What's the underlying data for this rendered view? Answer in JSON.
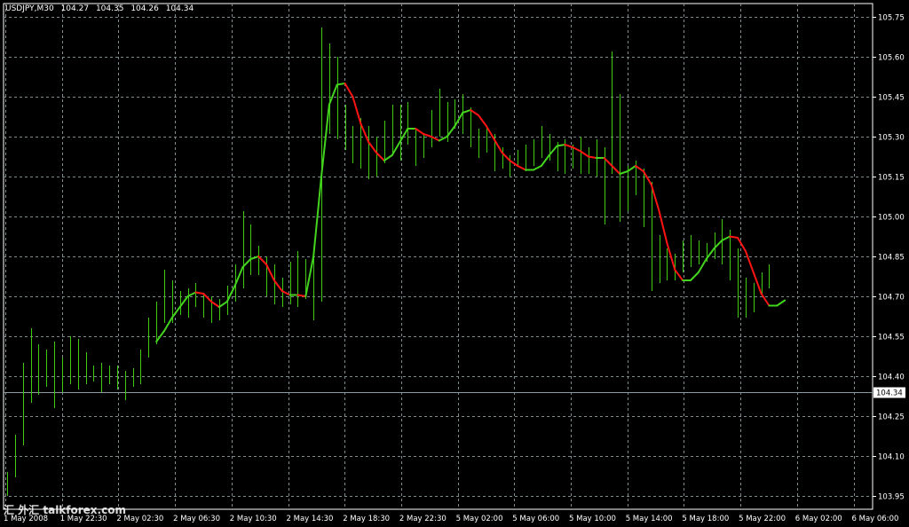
{
  "header": {
    "symbol": "USDJPY,M30",
    "open": "104.27",
    "high": "104.35",
    "low": "104.26",
    "close": "104.34"
  },
  "watermark": "汇 外汇 talkforex.com",
  "colors": {
    "background": "#000000",
    "grid": "#7f8c8d",
    "bars": "#3ecb12",
    "ma_up": "#43d41e",
    "ma_down": "#ff1414",
    "axis": "#ffffff",
    "bid_line": "#8c9aa3",
    "text": "#ffffff"
  },
  "chart_data": {
    "type": "line",
    "title": "USDJPY,M30",
    "price_axis_ticks": [
      "105.75",
      "105.60",
      "105.45",
      "105.30",
      "105.15",
      "105.00",
      "104.85",
      "104.70",
      "104.55",
      "104.40",
      "104.25",
      "104.10",
      "103.95"
    ],
    "time_axis_ticks": [
      "1 May 2008",
      "1 May 22:30",
      "2 May 02:30",
      "2 May 06:30",
      "2 May 10:30",
      "2 May 14:30",
      "2 May 18:30",
      "2 May 22:30",
      "5 May 02:00",
      "5 May 06:00",
      "5 May 10:00",
      "5 May 14:00",
      "5 May 18:00",
      "5 May 22:00",
      "6 May 02:00",
      "6 May 06:00"
    ],
    "ylim": [
      103.9,
      105.8
    ],
    "current_price": "104.34",
    "grid": true,
    "series": [
      {
        "type": "bars",
        "values": [
          {
            "h": 104.04,
            "l": 103.95
          },
          {
            "h": 104.18,
            "l": 104.02
          },
          {
            "h": 104.45,
            "l": 104.14
          },
          {
            "h": 104.58,
            "l": 104.3
          },
          {
            "h": 104.52,
            "l": 104.33
          },
          {
            "h": 104.5,
            "l": 104.36
          },
          {
            "h": 104.53,
            "l": 104.28
          },
          {
            "h": 104.47,
            "l": 104.34
          },
          {
            "h": 104.55,
            "l": 104.37
          },
          {
            "h": 104.54,
            "l": 104.35
          },
          {
            "h": 104.49,
            "l": 104.37
          },
          {
            "h": 104.44,
            "l": 104.38
          },
          {
            "h": 104.45,
            "l": 104.34
          },
          {
            "h": 104.44,
            "l": 104.37
          },
          {
            "h": 104.44,
            "l": 104.35
          },
          {
            "h": 104.42,
            "l": 104.31
          },
          {
            "h": 104.43,
            "l": 104.36
          },
          {
            "h": 104.5,
            "l": 104.37
          },
          {
            "h": 104.62,
            "l": 104.47
          },
          {
            "h": 104.68,
            "l": 104.52
          },
          {
            "h": 104.8,
            "l": 104.6
          },
          {
            "h": 104.76,
            "l": 104.6
          },
          {
            "h": 104.72,
            "l": 104.63
          },
          {
            "h": 104.73,
            "l": 104.62
          },
          {
            "h": 104.75,
            "l": 104.66
          },
          {
            "h": 104.71,
            "l": 104.62
          },
          {
            "h": 104.7,
            "l": 104.6
          },
          {
            "h": 104.69,
            "l": 104.61
          },
          {
            "h": 104.74,
            "l": 104.63
          },
          {
            "h": 104.82,
            "l": 104.68
          },
          {
            "h": 105.02,
            "l": 104.73
          },
          {
            "h": 104.97,
            "l": 104.78
          },
          {
            "h": 104.89,
            "l": 104.78
          },
          {
            "h": 104.85,
            "l": 104.7
          },
          {
            "h": 104.82,
            "l": 104.67
          },
          {
            "h": 104.77,
            "l": 104.66
          },
          {
            "h": 104.83,
            "l": 104.67
          },
          {
            "h": 104.87,
            "l": 104.66
          },
          {
            "h": 104.84,
            "l": 104.69
          },
          {
            "h": 104.87,
            "l": 104.61
          },
          {
            "h": 105.71,
            "l": 104.68
          },
          {
            "h": 105.65,
            "l": 105.31
          },
          {
            "h": 105.6,
            "l": 105.29
          },
          {
            "h": 105.42,
            "l": 105.25
          },
          {
            "h": 105.34,
            "l": 105.2
          },
          {
            "h": 105.37,
            "l": 105.18
          },
          {
            "h": 105.34,
            "l": 105.14
          },
          {
            "h": 105.3,
            "l": 105.15
          },
          {
            "h": 105.36,
            "l": 105.2
          },
          {
            "h": 105.42,
            "l": 105.23
          },
          {
            "h": 105.42,
            "l": 105.21
          },
          {
            "h": 105.43,
            "l": 105.27
          },
          {
            "h": 105.33,
            "l": 105.19
          },
          {
            "h": 105.31,
            "l": 105.22
          },
          {
            "h": 105.4,
            "l": 105.26
          },
          {
            "h": 105.48,
            "l": 105.3
          },
          {
            "h": 105.43,
            "l": 105.28
          },
          {
            "h": 105.44,
            "l": 105.33
          },
          {
            "h": 105.46,
            "l": 105.31
          },
          {
            "h": 105.41,
            "l": 105.26
          },
          {
            "h": 105.33,
            "l": 105.22
          },
          {
            "h": 105.34,
            "l": 105.24
          },
          {
            "h": 105.31,
            "l": 105.17
          },
          {
            "h": 105.26,
            "l": 105.18
          },
          {
            "h": 105.23,
            "l": 105.15
          },
          {
            "h": 105.25,
            "l": 105.19
          },
          {
            "h": 105.27,
            "l": 105.17
          },
          {
            "h": 105.29,
            "l": 105.19
          },
          {
            "h": 105.34,
            "l": 105.22
          },
          {
            "h": 105.31,
            "l": 105.21
          },
          {
            "h": 105.28,
            "l": 105.17
          },
          {
            "h": 105.29,
            "l": 105.16
          },
          {
            "h": 105.27,
            "l": 105.18
          },
          {
            "h": 105.3,
            "l": 105.16
          },
          {
            "h": 105.26,
            "l": 105.16
          },
          {
            "h": 105.29,
            "l": 105.15
          },
          {
            "h": 105.26,
            "l": 104.97
          },
          {
            "h": 105.62,
            "l": 105.16
          },
          {
            "h": 105.46,
            "l": 104.98
          },
          {
            "h": 105.19,
            "l": 105.02
          },
          {
            "h": 105.21,
            "l": 105.08
          },
          {
            "h": 105.18,
            "l": 104.96
          },
          {
            "h": 105.13,
            "l": 104.72
          },
          {
            "h": 104.93,
            "l": 104.75
          },
          {
            "h": 104.88,
            "l": 104.76
          },
          {
            "h": 104.86,
            "l": 104.76
          },
          {
            "h": 104.91,
            "l": 104.79
          },
          {
            "h": 104.93,
            "l": 104.81
          },
          {
            "h": 104.91,
            "l": 104.82
          },
          {
            "h": 104.9,
            "l": 104.83
          },
          {
            "h": 104.94,
            "l": 104.84
          },
          {
            "h": 104.99,
            "l": 104.82
          },
          {
            "h": 104.95,
            "l": 104.76
          },
          {
            "h": 104.88,
            "l": 104.62
          },
          {
            "h": 104.77,
            "l": 104.62
          },
          {
            "h": 104.75,
            "l": 104.64
          },
          {
            "h": 104.79,
            "l": 104.71
          },
          {
            "h": 104.82,
            "l": 104.73
          }
        ]
      },
      {
        "type": "moving-average",
        "values": [
          {
            "x": 19,
            "y": 104.53
          },
          {
            "x": 20,
            "y": 104.57
          },
          {
            "x": 21,
            "y": 104.62
          },
          {
            "x": 22,
            "y": 104.66
          },
          {
            "x": 23,
            "y": 104.7
          },
          {
            "x": 24,
            "y": 104.715
          },
          {
            "x": 25,
            "y": 104.71
          },
          {
            "x": 26,
            "y": 104.68
          },
          {
            "x": 27,
            "y": 104.66
          },
          {
            "x": 28,
            "y": 104.68
          },
          {
            "x": 29,
            "y": 104.74
          },
          {
            "x": 30,
            "y": 104.81
          },
          {
            "x": 31,
            "y": 104.84
          },
          {
            "x": 32,
            "y": 104.85
          },
          {
            "x": 33,
            "y": 104.82
          },
          {
            "x": 34,
            "y": 104.76
          },
          {
            "x": 35,
            "y": 104.72
          },
          {
            "x": 36,
            "y": 104.705
          },
          {
            "x": 37,
            "y": 104.705
          },
          {
            "x": 38,
            "y": 104.7
          },
          {
            "x": 39,
            "y": 104.85
          },
          {
            "x": 40,
            "y": 105.15
          },
          {
            "x": 41,
            "y": 105.42
          },
          {
            "x": 42,
            "y": 105.495
          },
          {
            "x": 43,
            "y": 105.5
          },
          {
            "x": 44,
            "y": 105.45
          },
          {
            "x": 45,
            "y": 105.35
          },
          {
            "x": 46,
            "y": 105.28
          },
          {
            "x": 47,
            "y": 105.24
          },
          {
            "x": 48,
            "y": 105.21
          },
          {
            "x": 49,
            "y": 105.23
          },
          {
            "x": 50,
            "y": 105.28
          },
          {
            "x": 51,
            "y": 105.33
          },
          {
            "x": 52,
            "y": 105.33
          },
          {
            "x": 53,
            "y": 105.31
          },
          {
            "x": 54,
            "y": 105.3
          },
          {
            "x": 55,
            "y": 105.285
          },
          {
            "x": 56,
            "y": 105.3
          },
          {
            "x": 57,
            "y": 105.34
          },
          {
            "x": 58,
            "y": 105.39
          },
          {
            "x": 59,
            "y": 105.4
          },
          {
            "x": 60,
            "y": 105.38
          },
          {
            "x": 61,
            "y": 105.34
          },
          {
            "x": 62,
            "y": 105.29
          },
          {
            "x": 63,
            "y": 105.24
          },
          {
            "x": 64,
            "y": 105.21
          },
          {
            "x": 65,
            "y": 105.19
          },
          {
            "x": 66,
            "y": 105.175
          },
          {
            "x": 67,
            "y": 105.175
          },
          {
            "x": 68,
            "y": 105.19
          },
          {
            "x": 69,
            "y": 105.23
          },
          {
            "x": 70,
            "y": 105.265
          },
          {
            "x": 71,
            "y": 105.27
          },
          {
            "x": 72,
            "y": 105.26
          },
          {
            "x": 73,
            "y": 105.245
          },
          {
            "x": 74,
            "y": 105.225
          },
          {
            "x": 75,
            "y": 105.22
          },
          {
            "x": 76,
            "y": 105.22
          },
          {
            "x": 77,
            "y": 105.19
          },
          {
            "x": 78,
            "y": 105.16
          },
          {
            "x": 79,
            "y": 105.17
          },
          {
            "x": 80,
            "y": 105.19
          },
          {
            "x": 81,
            "y": 105.17
          },
          {
            "x": 82,
            "y": 105.12
          },
          {
            "x": 83,
            "y": 105.02
          },
          {
            "x": 84,
            "y": 104.9
          },
          {
            "x": 85,
            "y": 104.8
          },
          {
            "x": 86,
            "y": 104.76
          },
          {
            "x": 87,
            "y": 104.76
          },
          {
            "x": 88,
            "y": 104.79
          },
          {
            "x": 89,
            "y": 104.84
          },
          {
            "x": 90,
            "y": 104.88
          },
          {
            "x": 91,
            "y": 104.91
          },
          {
            "x": 92,
            "y": 104.925
          },
          {
            "x": 93,
            "y": 104.92
          },
          {
            "x": 94,
            "y": 104.87
          },
          {
            "x": 95,
            "y": 104.79
          },
          {
            "x": 96,
            "y": 104.71
          },
          {
            "x": 97,
            "y": 104.665
          },
          {
            "x": 98,
            "y": 104.665
          },
          {
            "x": 99,
            "y": 104.685
          }
        ]
      }
    ]
  }
}
